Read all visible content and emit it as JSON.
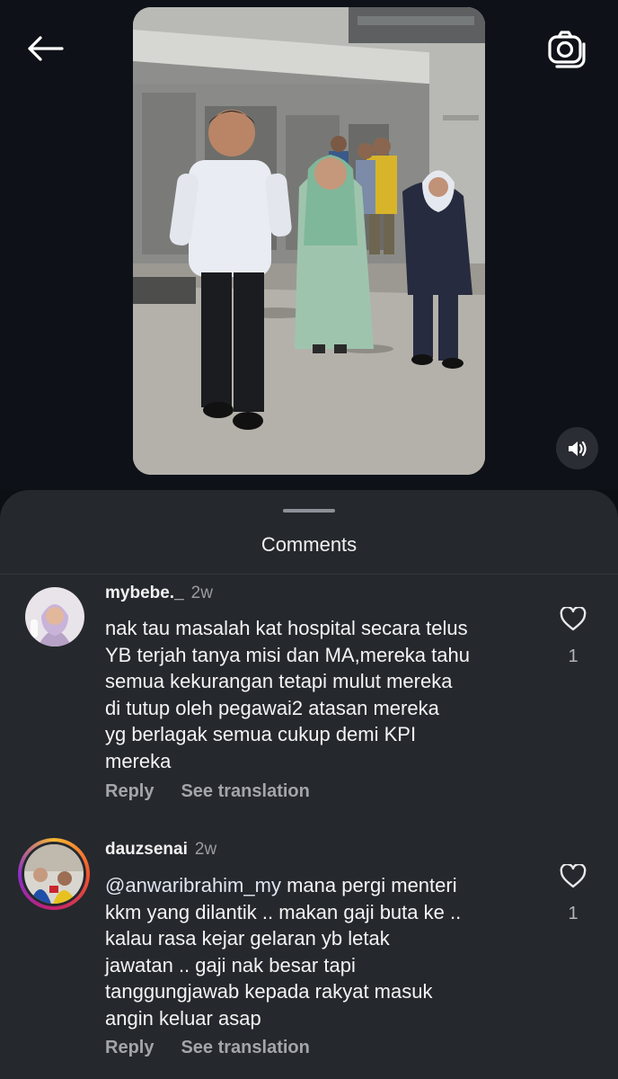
{
  "header": {
    "back_icon": "arrow-left-icon",
    "camera_icon": "camera-icon",
    "sound_icon": "volume-icon"
  },
  "sheet": {
    "title": "Comments"
  },
  "comments": [
    {
      "username": "mybebe._",
      "time": "2w",
      "mention": "",
      "text": "nak tau masalah kat hospital secara telus\nYB terjah tanya misi dan MA,mereka tahu\nsemua kekurangan tetapi mulut mereka\ndi tutup oleh pegawai2 atasan mereka\nyg berlagak semua cukup demi KPI\nmereka",
      "reply_label": "Reply",
      "translate_label": "See translation",
      "likes": "1"
    },
    {
      "username": "dauzsenai",
      "time": "2w",
      "mention": "@anwaribrahim_my",
      "text": "  mana pergi menteri\nkkm yang dilantik .. makan gaji buta ke ..\nkalau rasa kejar gelaran yb letak\njawatan .. gaji nak besar tapi\ntanggungjawab kepada rakyat masuk\nangin keluar asap",
      "reply_label": "Reply",
      "translate_label": "See translation",
      "likes": "1"
    }
  ],
  "colors": {
    "background": "#0c0f14",
    "sheet": "#25282d",
    "secondary_text": "#a3a5aa"
  }
}
